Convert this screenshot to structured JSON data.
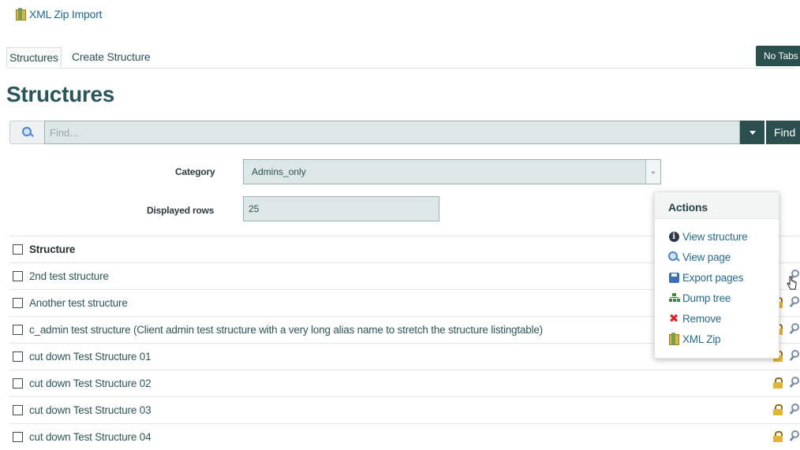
{
  "header": {
    "import_link": "XML Zip Import"
  },
  "tabs": [
    {
      "label": "Structures",
      "active": true
    },
    {
      "label": "Create Structure",
      "active": false
    }
  ],
  "no_tabs_button": "No Tabs",
  "page_title": "Structures",
  "search": {
    "placeholder": "Find...",
    "value": "",
    "find_label": "Find"
  },
  "filters": {
    "category_label": "Category",
    "category_value": "Admins_only",
    "rows_label": "Displayed rows",
    "rows_value": "25"
  },
  "table": {
    "header": "Structure",
    "rows": [
      "2nd test structure",
      "Another test structure",
      "c_admin test structure (Client admin test structure with a very long alias name to stretch the structure listingtable)",
      "cut down Test Structure 01",
      "cut down Test Structure 02",
      "cut down Test Structure 03",
      "cut down Test Structure 04"
    ]
  },
  "actions_menu": {
    "title": "Actions",
    "items": [
      {
        "label": "View structure",
        "icon": "info-icon"
      },
      {
        "label": "View page",
        "icon": "magnifier-icon"
      },
      {
        "label": "Export pages",
        "icon": "save-icon"
      },
      {
        "label": "Dump tree",
        "icon": "tree-icon"
      },
      {
        "label": "Remove",
        "icon": "remove-icon"
      },
      {
        "label": "XML Zip",
        "icon": "zip-icon"
      }
    ]
  },
  "colors": {
    "accent": "#2b4f4e",
    "link": "#2a6a89",
    "input_bg": "#dde7e6"
  }
}
